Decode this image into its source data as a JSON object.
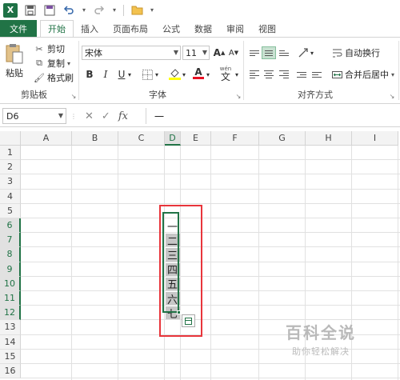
{
  "qat": {
    "app_icon_label": "X",
    "icons": [
      "save-icon",
      "save-as-icon",
      "undo-icon",
      "redo-icon",
      "open-folder-icon"
    ]
  },
  "tabs": [
    "文件",
    "开始",
    "插入",
    "页面布局",
    "公式",
    "数据",
    "审阅",
    "视图"
  ],
  "ribbon": {
    "clipboard": {
      "paste_label": "粘贴",
      "cut_label": "剪切",
      "copy_label": "复制",
      "format_painter_label": "格式刷",
      "group_label": "剪贴板"
    },
    "font": {
      "font_name": "宋体",
      "font_size": "11",
      "grow_label": "A",
      "shrink_label": "A",
      "bold": "B",
      "italic": "I",
      "underline": "U",
      "wen_label": "wén",
      "wen_char": "文",
      "group_label": "字体"
    },
    "alignment": {
      "wrap_label": "自动换行",
      "merge_label": "合并后居中",
      "group_label": "对齐方式"
    }
  },
  "formula_bar": {
    "name_box": "D6",
    "cancel_icon": "✕",
    "confirm_icon": "✓",
    "fx_label": "fx",
    "content": "一"
  },
  "grid": {
    "columns": [
      "A",
      "B",
      "C",
      "D",
      "E",
      "F",
      "G",
      "H",
      "I"
    ],
    "rows": [
      "1",
      "2",
      "3",
      "4",
      "5",
      "6",
      "7",
      "8",
      "9",
      "10",
      "11",
      "12",
      "13",
      "14",
      "15",
      "16"
    ],
    "selected_column": "D",
    "selected_rows": [
      "6",
      "7",
      "8",
      "9",
      "10",
      "11",
      "12"
    ],
    "d_values": [
      "一",
      "二",
      "三",
      "四",
      "五",
      "六",
      "七"
    ]
  },
  "colors": {
    "excel_green": "#217346",
    "annotation_red": "#e8353b",
    "selection_fill": "#c6c6c6"
  },
  "watermark": {
    "title": "百科全说",
    "subtitle": "助你轻松解决"
  }
}
